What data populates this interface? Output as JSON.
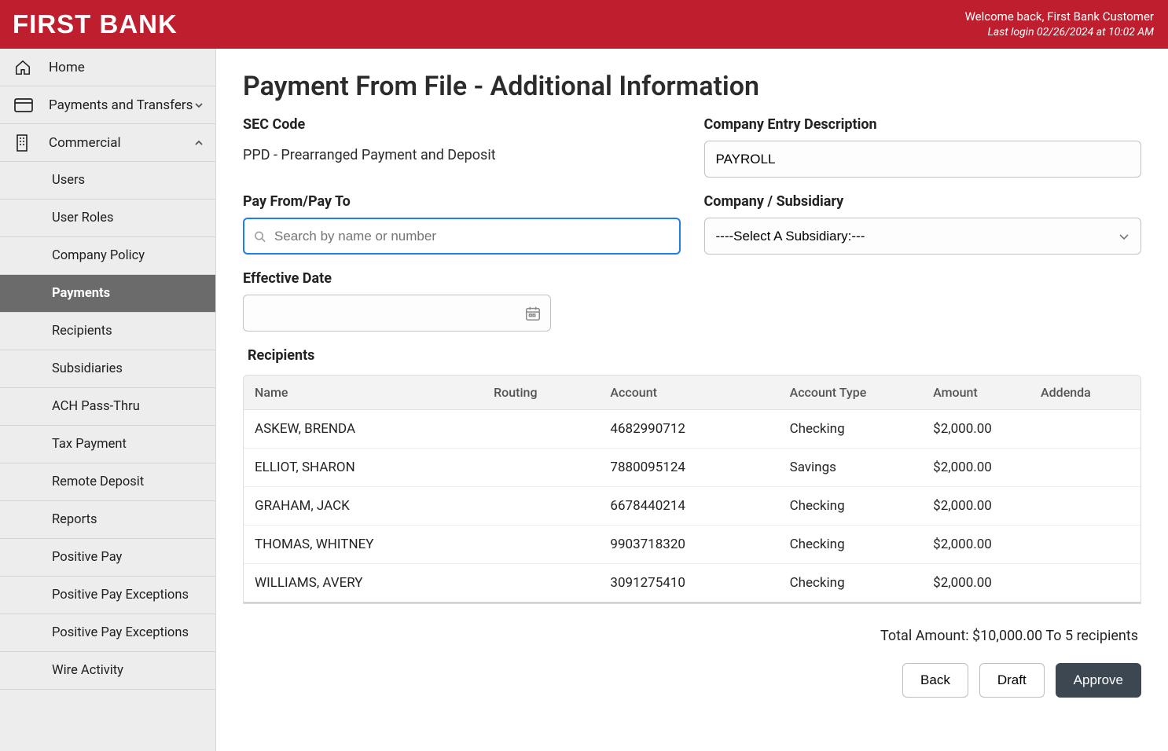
{
  "header": {
    "logo": "FIRST BANK",
    "welcome": "Welcome back, First Bank Customer",
    "last_login": "Last login 02/26/2024 at 10:02 AM"
  },
  "sidebar": {
    "home": "Home",
    "payments_transfers": "Payments and Transfers",
    "commercial": "Commercial",
    "sub": {
      "users": "Users",
      "user_roles": "User Roles",
      "company_policy": "Company Policy",
      "payments": "Payments",
      "recipients": "Recipients",
      "subsidiaries": "Subsidiaries",
      "ach_pass_thru": "ACH Pass-Thru",
      "tax_payment": "Tax Payment",
      "remote_deposit": "Remote Deposit",
      "reports": "Reports",
      "positive_pay": "Positive Pay",
      "positive_pay_exceptions_1": "Positive Pay Exceptions",
      "positive_pay_exceptions_2": "Positive Pay Exceptions",
      "wire_activity": "Wire Activity"
    }
  },
  "page": {
    "title": "Payment From File - Additional Information",
    "sec_code_label": "SEC Code",
    "sec_code_value": "PPD - Prearranged Payment and Deposit",
    "company_entry_label": "Company Entry Description",
    "company_entry_value": "PAYROLL",
    "pay_from_label": "Pay From/Pay To",
    "pay_from_placeholder": "Search by name or number",
    "company_subsidiary_label": "Company / Subsidiary",
    "company_subsidiary_value": "----Select A Subsidiary:---",
    "effective_date_label": "Effective Date",
    "effective_date_value": "",
    "recipients_label": "Recipients",
    "table": {
      "cols": {
        "name": "Name",
        "routing": "Routing",
        "account": "Account",
        "account_type": "Account Type",
        "amount": "Amount",
        "addenda": "Addenda"
      },
      "rows": [
        {
          "name": "ASKEW, BRENDA",
          "routing": "",
          "account": "4682990712",
          "account_type": "Checking",
          "amount": "$2,000.00",
          "addenda": ""
        },
        {
          "name": "ELLIOT, SHARON",
          "routing": "",
          "account": "7880095124",
          "account_type": "Savings",
          "amount": "$2,000.00",
          "addenda": ""
        },
        {
          "name": "GRAHAM, JACK",
          "routing": "",
          "account": "6678440214",
          "account_type": "Checking",
          "amount": "$2,000.00",
          "addenda": ""
        },
        {
          "name": "THOMAS, WHITNEY",
          "routing": "",
          "account": "9903718320",
          "account_type": "Checking",
          "amount": "$2,000.00",
          "addenda": ""
        },
        {
          "name": "WILLIAMS, AVERY",
          "routing": "",
          "account": "3091275410",
          "account_type": "Checking",
          "amount": "$2,000.00",
          "addenda": ""
        }
      ]
    },
    "total_line": "Total Amount: $10,000.00 To 5 recipients",
    "buttons": {
      "back": "Back",
      "draft": "Draft",
      "approve": "Approve"
    }
  }
}
